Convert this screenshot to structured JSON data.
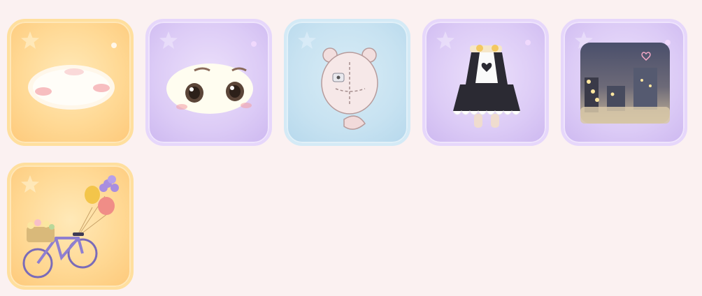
{
  "inventory": {
    "items": [
      {
        "name": "makeup-blush",
        "rarity": "gold"
      },
      {
        "name": "makeup-eyes",
        "rarity": "purple"
      },
      {
        "name": "bear-plush-accessory",
        "rarity": "blue"
      },
      {
        "name": "maid-dress",
        "rarity": "purple"
      },
      {
        "name": "night-street-background",
        "rarity": "purple"
      },
      {
        "name": "balloon-bicycle",
        "rarity": "gold"
      }
    ]
  },
  "colors": {
    "page_bg": "#fbf1f1",
    "gold": "#ffd995",
    "purple": "#dccbf6",
    "blue": "#c7e2f1"
  },
  "icons": [
    "star-icon",
    "sparkle-icon"
  ]
}
